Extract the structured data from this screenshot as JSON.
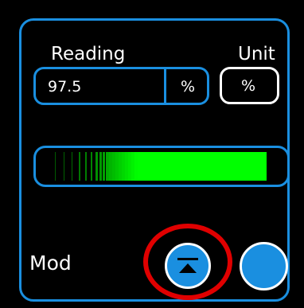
{
  "reading": {
    "label": "Reading",
    "value": "97.5",
    "unit": "%"
  },
  "unit": {
    "label": "Unit",
    "value": "%"
  },
  "bar": {
    "level": 0.975,
    "fill_color": "#00ff00",
    "frame_color": "#1a8fe0"
  },
  "mod": {
    "label": "Mod"
  },
  "colors": {
    "accent": "#1a8fe0",
    "background": "#000000",
    "highlight": "#e00000"
  },
  "icons": {
    "up_button": "move-to-top-icon"
  }
}
